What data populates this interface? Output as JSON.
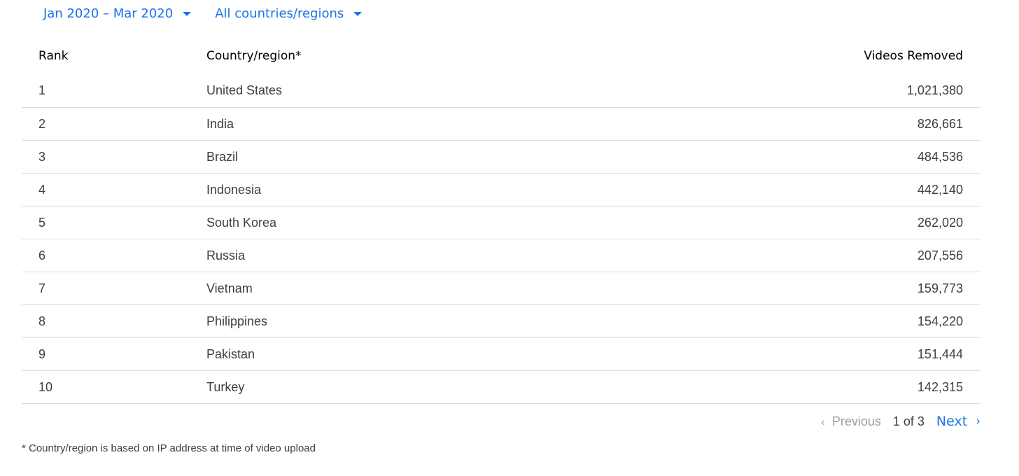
{
  "filters": {
    "date_range": "Jan 2020 – Mar 2020",
    "region": "All countries/regions"
  },
  "table": {
    "headers": {
      "rank": "Rank",
      "country": "Country/region*",
      "videos": "Videos Removed"
    },
    "rows": [
      {
        "rank": "1",
        "country": "United States",
        "videos": "1,021,380"
      },
      {
        "rank": "2",
        "country": "India",
        "videos": "826,661"
      },
      {
        "rank": "3",
        "country": "Brazil",
        "videos": "484,536"
      },
      {
        "rank": "4",
        "country": "Indonesia",
        "videos": "442,140"
      },
      {
        "rank": "5",
        "country": "South Korea",
        "videos": "262,020"
      },
      {
        "rank": "6",
        "country": "Russia",
        "videos": "207,556"
      },
      {
        "rank": "7",
        "country": "Vietnam",
        "videos": "159,773"
      },
      {
        "rank": "8",
        "country": "Philippines",
        "videos": "154,220"
      },
      {
        "rank": "9",
        "country": "Pakistan",
        "videos": "151,444"
      },
      {
        "rank": "10",
        "country": "Turkey",
        "videos": "142,315"
      }
    ]
  },
  "pagination": {
    "previous_label": "Previous",
    "page_status": "1 of 3",
    "next_label": "Next",
    "previous_icon": "chevron-left-icon",
    "next_icon": "chevron-right-icon"
  },
  "footnote": "* Country/region is based on IP address at time of video upload",
  "colors": {
    "accent": "#1a73e8",
    "disabled": "#9aa0a6",
    "divider": "#dadce0",
    "text": "#3c4043"
  }
}
